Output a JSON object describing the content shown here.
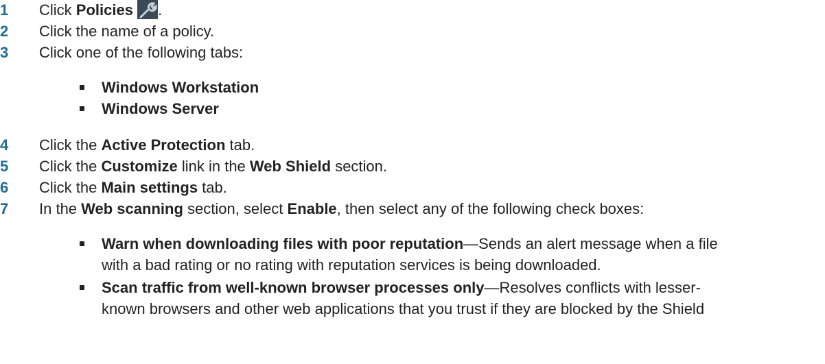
{
  "steps": [
    {
      "num": "1",
      "pre": "Click ",
      "b1": "Policies",
      "post": "."
    },
    {
      "num": "2",
      "text": "Click the name of a policy."
    },
    {
      "num": "3",
      "text": "Click one of the following tabs:"
    },
    {
      "num": "4",
      "pre": "Click the ",
      "b1": "Active Protection",
      "post": " tab."
    },
    {
      "num": "5",
      "pre": "Click the ",
      "b1": "Customize",
      "mid": " link in the ",
      "b2": "Web Shield",
      "post": " section."
    },
    {
      "num": "6",
      "pre": "Click the ",
      "b1": "Main settings",
      "post": " tab."
    },
    {
      "num": "7",
      "pre": "In the ",
      "b1": "Web scanning",
      "mid": " section, select ",
      "b2": "Enable",
      "post": ", then select any of the following check boxes:"
    }
  ],
  "tabs": [
    "Windows Workstation",
    "Windows Server"
  ],
  "checkboxes": [
    {
      "title": "Warn when downloading files with poor reputation",
      "desc1": "—Sends an alert message when a file",
      "desc2": "with a bad rating or no rating with reputation services is being downloaded."
    },
    {
      "title": "Scan traffic from well-known browser processes only",
      "desc1": "—Resolves conflicts with lesser-",
      "desc2": "known browsers and other web applications that you trust if they are blocked by the Shield"
    }
  ],
  "icon": "wrench-icon"
}
